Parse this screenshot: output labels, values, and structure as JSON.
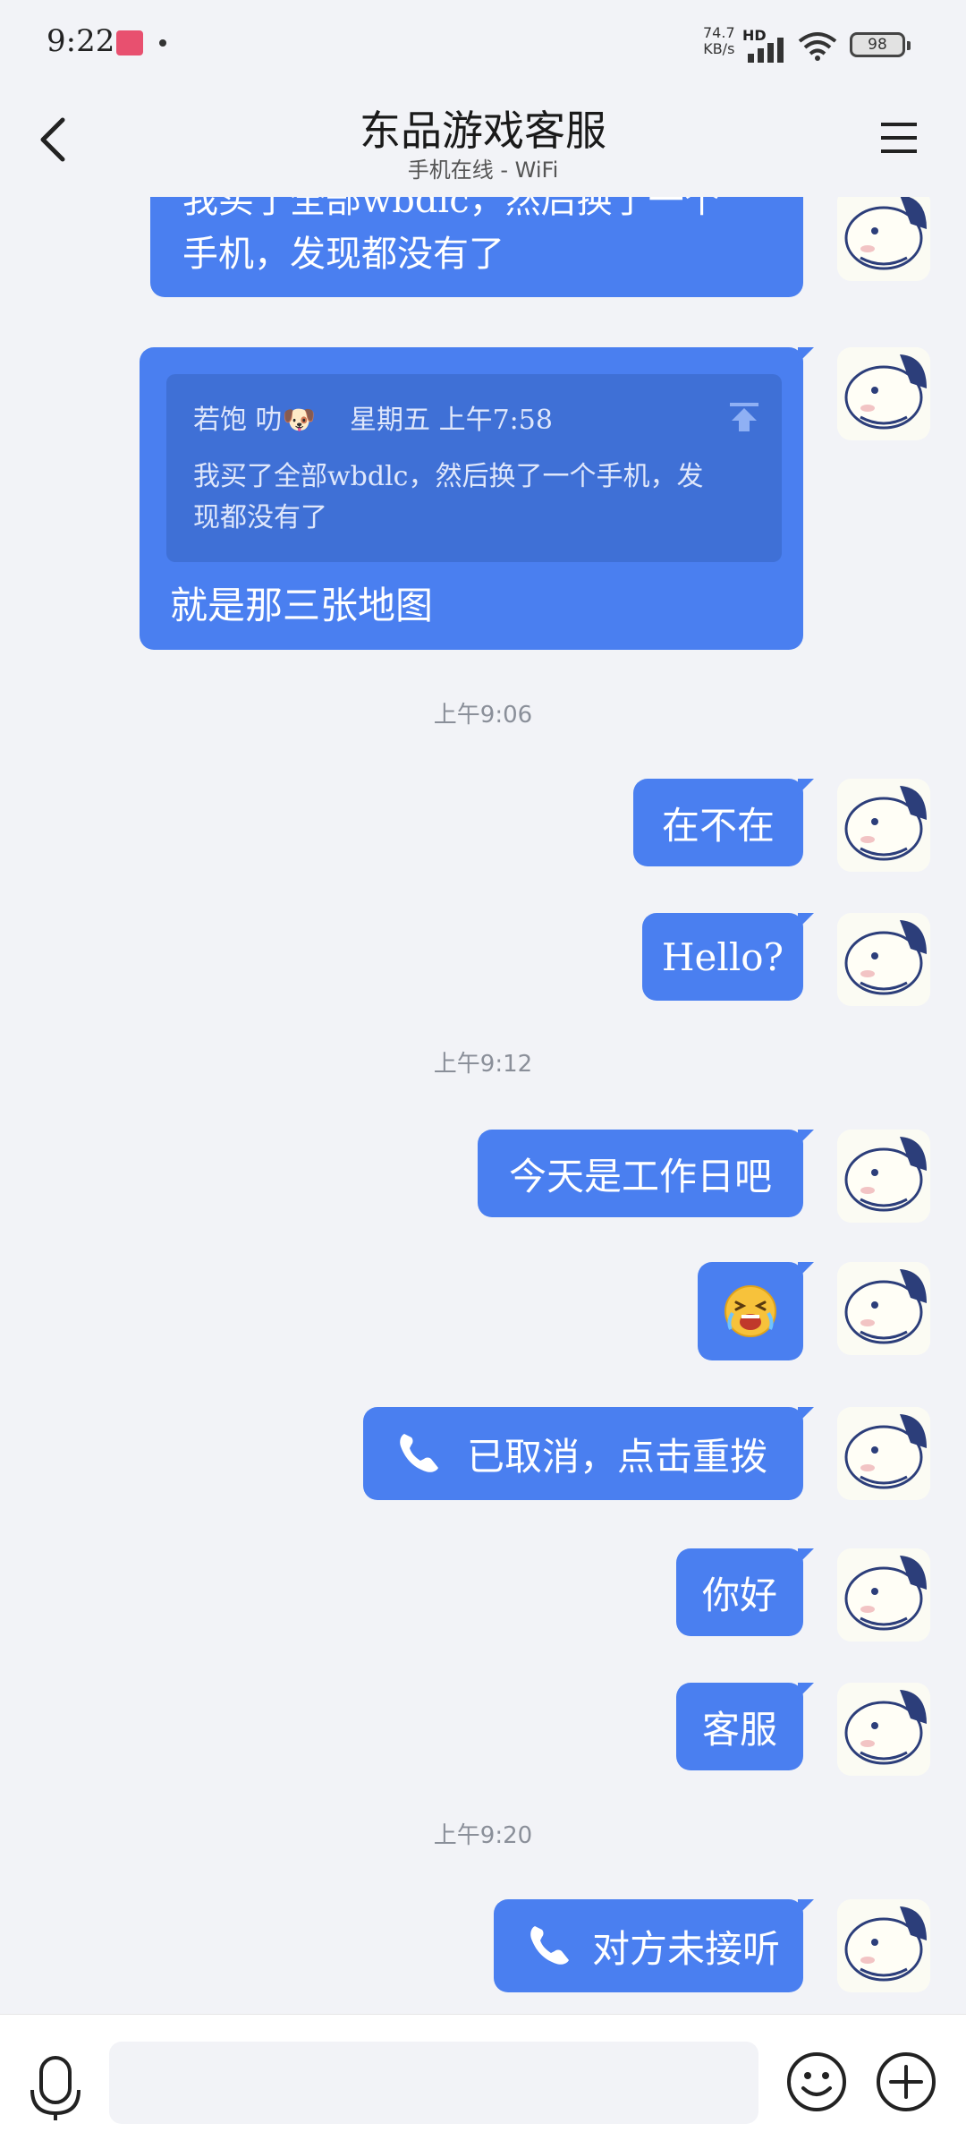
{
  "status": {
    "time": "9:22",
    "net_speed": "74.7",
    "net_unit": "KB/s",
    "hd": "HD",
    "battery": "98"
  },
  "header": {
    "title": "东品游戏客服",
    "subtitle": "手机在线 - WiFi"
  },
  "messages": {
    "m0": "我买了全部wbdlc，然后换了一个\n手机，发现都没有了",
    "quote_sender": "若饱 叻🐶",
    "quote_time": "星期五 上午7:58",
    "quote_text": "我买了全部wbdlc，然后换了一个手机，发现都没有了",
    "m1": "就是那三张地图",
    "ts1": "上午9:06",
    "m2": "在不在",
    "m3": "Hello?",
    "ts2": "上午9:12",
    "m4": "今天是工作日吧",
    "m6": "已取消，点击重拨",
    "m7": "你好",
    "m8": "客服",
    "ts3": "上午9:20",
    "m9": "对方未接听"
  },
  "colors": {
    "bubble": "#4a7ff0",
    "background": "#f2f3f7"
  },
  "icons": [
    "back-icon",
    "menu-icon",
    "phone-icon",
    "pin-top-icon",
    "mic-icon",
    "emoji-icon",
    "plus-icon"
  ]
}
